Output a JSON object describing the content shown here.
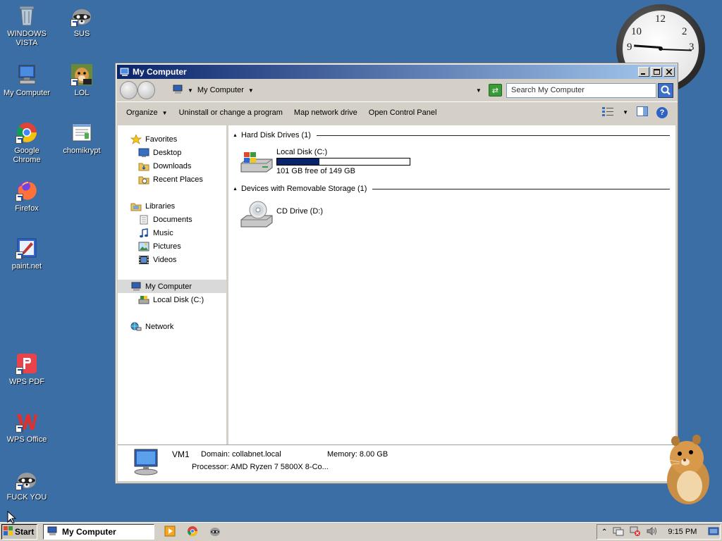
{
  "desktop": {
    "icons": [
      {
        "label": "WINDOWS VISTA",
        "icon": "recycle-bin-icon"
      },
      {
        "label": "SUS",
        "icon": "raccoon-icon"
      },
      {
        "label": "My Computer",
        "icon": "computer-icon"
      },
      {
        "label": "LOL",
        "icon": "hamster-box-icon"
      },
      {
        "label": "Google Chrome",
        "icon": "chrome-icon"
      },
      {
        "label": "chomikrypt",
        "icon": "document-icon"
      },
      {
        "label": "Firefox",
        "icon": "firefox-icon"
      },
      {
        "label": "paint.net",
        "icon": "paintnet-icon"
      },
      {
        "label": "WPS PDF",
        "icon": "wps-pdf-icon"
      },
      {
        "label": "WPS Office",
        "icon": "wps-office-icon"
      },
      {
        "label": "FUCK YOU",
        "icon": "raccoon-icon"
      }
    ]
  },
  "clock": {
    "numbers": [
      "12",
      "2",
      "3",
      "9",
      "10"
    ],
    "time": "9:15"
  },
  "window": {
    "title": "My Computer",
    "address": "My Computer",
    "search_placeholder": "Search My Computer",
    "commands": [
      "Organize",
      "Uninstall or change a program",
      "Map network drive",
      "Open Control Panel"
    ],
    "nav": {
      "favorites": "Favorites",
      "desktop": "Desktop",
      "downloads": "Downloads",
      "recent": "Recent Places",
      "libraries": "Libraries",
      "documents": "Documents",
      "music": "Music",
      "pictures": "Pictures",
      "videos": "Videos",
      "computer": "My Computer",
      "local_disk": "Local Disk (C:)",
      "network": "Network"
    },
    "groups": {
      "hdd": "Hard Disk Drives (1)",
      "removable": "Devices with Removable Storage (1)"
    },
    "drives": {
      "c_name": "Local Disk (C:)",
      "c_free": "101 GB free of 149 GB",
      "c_used_fraction": 0.32,
      "d_name": "CD Drive (D:)"
    },
    "details": {
      "name": "VM1",
      "domain": "Domain: collabnet.local",
      "memory": "Memory: 8.00 GB",
      "processor": "Processor: AMD Ryzen 7 5800X 8-Co..."
    }
  },
  "taskbar": {
    "start": "Start",
    "active_task": "My Computer",
    "time": "9:15 PM"
  }
}
